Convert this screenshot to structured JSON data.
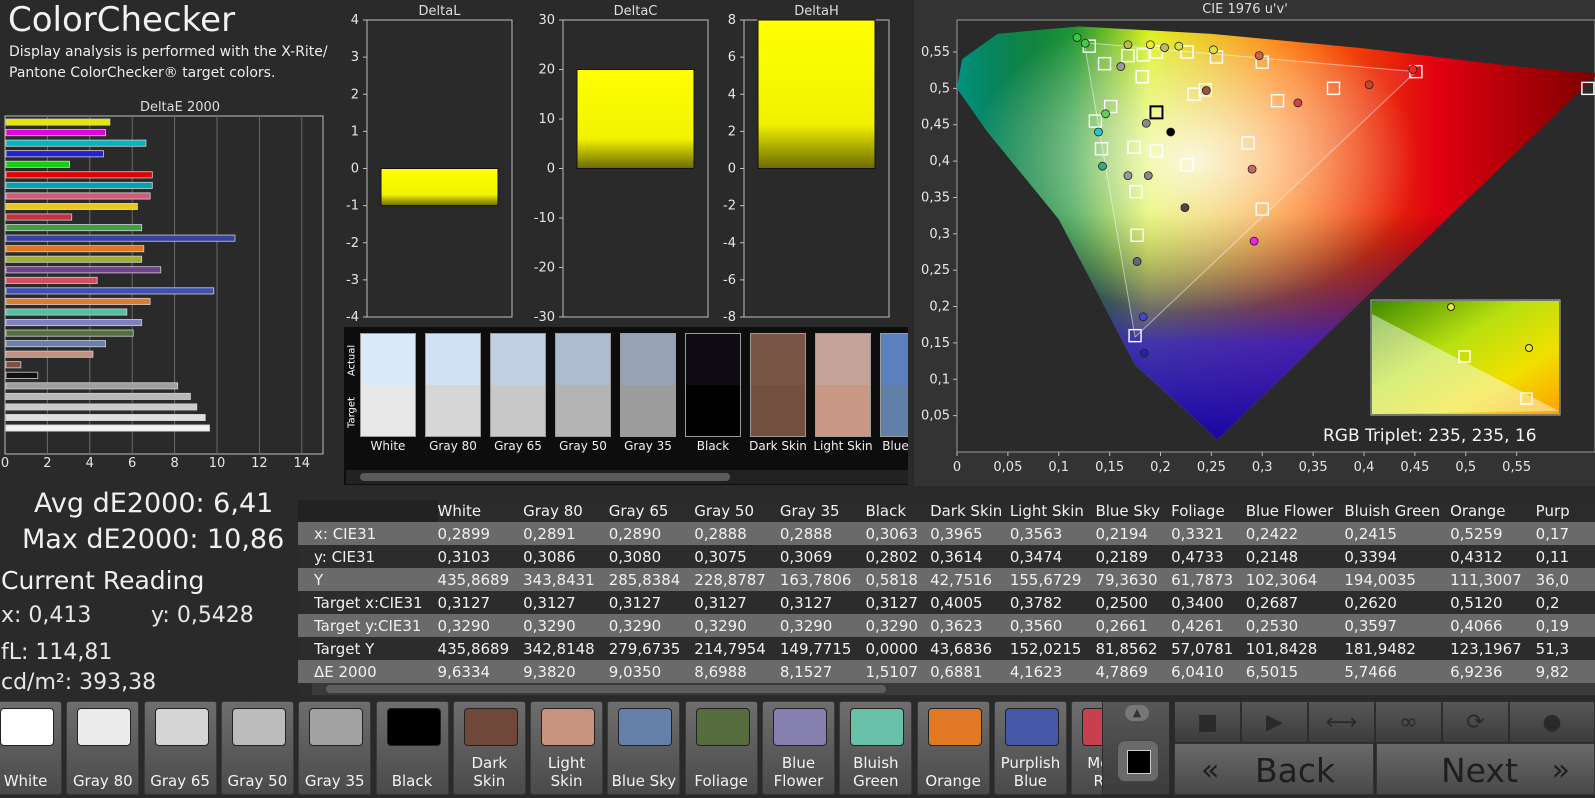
{
  "header": {
    "title": "ColorChecker",
    "subtitle": "Display analysis is performed with the X-Rite/ Pantone ColorChecker® target colors."
  },
  "deltae_chart": {
    "title": "DeltaE 2000",
    "ticks": [
      "0",
      "2",
      "4",
      "6",
      "8",
      "10",
      "12",
      "14"
    ],
    "xmax": 15,
    "bars": [
      {
        "value": 4.9,
        "color": "#e6e600"
      },
      {
        "value": 4.7,
        "color": "#e000e0"
      },
      {
        "value": 6.6,
        "color": "#00b6c4"
      },
      {
        "value": 4.6,
        "color": "#2222d0"
      },
      {
        "value": 3.0,
        "color": "#10d010"
      },
      {
        "value": 6.9,
        "color": "#e00000"
      },
      {
        "value": 6.9,
        "color": "#00a4b0"
      },
      {
        "value": 6.8,
        "color": "#d85878"
      },
      {
        "value": 6.2,
        "color": "#e8c820"
      },
      {
        "value": 3.1,
        "color": "#c83040"
      },
      {
        "value": 6.4,
        "color": "#40a040"
      },
      {
        "value": 10.8,
        "color": "#3840a0"
      },
      {
        "value": 6.5,
        "color": "#e07820"
      },
      {
        "value": 6.4,
        "color": "#a0b030"
      },
      {
        "value": 7.3,
        "color": "#704090"
      },
      {
        "value": 4.3,
        "color": "#d05060"
      },
      {
        "value": 9.8,
        "color": "#4050b0"
      },
      {
        "value": 6.8,
        "color": "#e07a30"
      },
      {
        "value": 5.7,
        "color": "#50c0a0"
      },
      {
        "value": 6.4,
        "color": "#8080c0"
      },
      {
        "value": 6.0,
        "color": "#507040"
      },
      {
        "value": 4.7,
        "color": "#6880b0"
      },
      {
        "value": 4.1,
        "color": "#c09080"
      },
      {
        "value": 0.7,
        "color": "#805040"
      },
      {
        "value": 1.5,
        "color": "#101010"
      },
      {
        "value": 8.1,
        "color": "#a0a0a0"
      },
      {
        "value": 8.7,
        "color": "#b8b8b8"
      },
      {
        "value": 9.0,
        "color": "#cccccc"
      },
      {
        "value": 9.4,
        "color": "#e0e0e0"
      },
      {
        "value": 9.6,
        "color": "#f4f4f4"
      }
    ]
  },
  "delta_charts": [
    {
      "title": "DeltaL",
      "ticks": [
        "4",
        "3",
        "2",
        "1",
        "0",
        "-1",
        "-2",
        "-3",
        "-4"
      ],
      "min": -4,
      "max": 4,
      "value": -1.0
    },
    {
      "title": "DeltaC",
      "ticks": [
        "30",
        "20",
        "10",
        "0",
        "-10",
        "-20",
        "-30"
      ],
      "min": -30,
      "max": 30,
      "value": 20
    },
    {
      "title": "DeltaH",
      "ticks": [
        "8",
        "6",
        "4",
        "2",
        "0",
        "-2",
        "-4",
        "-6",
        "-8"
      ],
      "min": -8,
      "max": 8,
      "value": 8
    }
  ],
  "strip": {
    "actual_label": "Actual",
    "target_label": "Target",
    "patches": [
      {
        "label": "White",
        "actual": "#dce9f8",
        "target": "#e8e8e8"
      },
      {
        "label": "Gray 80",
        "actual": "#d2e2f6",
        "target": "#d6d6d6"
      },
      {
        "label": "Gray 65",
        "actual": "#c2d0e4",
        "target": "#c8c8c8"
      },
      {
        "label": "Gray 50",
        "actual": "#aebccf",
        "target": "#b4b4b4"
      },
      {
        "label": "Gray 35",
        "actual": "#98a4b4",
        "target": "#9c9c9c"
      },
      {
        "label": "Black",
        "actual": "#0e0c12",
        "target": "#020202"
      },
      {
        "label": "Dark Skin",
        "actual": "#7a5444",
        "target": "#745040"
      },
      {
        "label": "Light Skin",
        "actual": "#c4a498",
        "target": "#c89884"
      },
      {
        "label": "Blue Sky",
        "actual": "#5a80c0",
        "target": "#6080a8"
      }
    ]
  },
  "cie": {
    "title": "CIE 1976 u'v'",
    "yticks": [
      "0,55",
      "0,5",
      "0,45",
      "0,4",
      "0,35",
      "0,3",
      "0,25",
      "0,2",
      "0,15",
      "0,1",
      "0,05"
    ],
    "xticks": [
      "0",
      "0,05",
      "0,1",
      "0,15",
      "0,2",
      "0,25",
      "0,3",
      "0,35",
      "0,4",
      "0,45",
      "0,5",
      "0,55"
    ],
    "rgb_triplet": "RGB Triplet: 235, 235, 16"
  },
  "stats": {
    "avg": "Avg dE2000: 6,41",
    "max": "Max dE2000: 10,86",
    "current_title": "Current Reading",
    "x": "x: 0,413",
    "y": "y: 0,5428",
    "fl": "fL: 114,81",
    "cd": "cd/m²: 393,38"
  },
  "table": {
    "columns": [
      "",
      "White",
      "Gray 80",
      "Gray 65",
      "Gray 50",
      "Gray 35",
      "Black",
      "Dark Skin",
      "Light Skin",
      "Blue Sky",
      "Foliage",
      "Blue Flower",
      "Bluish Green",
      "Orange",
      "Purp"
    ],
    "rows": [
      [
        "x: CIE31",
        "0,2899",
        "0,2891",
        "0,2890",
        "0,2888",
        "0,2888",
        "0,3063",
        "0,3965",
        "0,3563",
        "0,2194",
        "0,3321",
        "0,2422",
        "0,2415",
        "0,5259",
        "0,17"
      ],
      [
        "y: CIE31",
        "0,3103",
        "0,3086",
        "0,3080",
        "0,3075",
        "0,3069",
        "0,2802",
        "0,3614",
        "0,3474",
        "0,2189",
        "0,4733",
        "0,2148",
        "0,3394",
        "0,4312",
        "0,11"
      ],
      [
        "Y",
        "435,8689",
        "343,8431",
        "285,8384",
        "228,8787",
        "163,7806",
        "0,5818",
        "42,7516",
        "155,6729",
        "79,3630",
        "61,7873",
        "102,3064",
        "194,0035",
        "111,3007",
        "36,0"
      ],
      [
        "Target x:CIE31",
        "0,3127",
        "0,3127",
        "0,3127",
        "0,3127",
        "0,3127",
        "0,3127",
        "0,4005",
        "0,3782",
        "0,2500",
        "0,3400",
        "0,2687",
        "0,2620",
        "0,5120",
        "0,2"
      ],
      [
        "Target y:CIE31",
        "0,3290",
        "0,3290",
        "0,3290",
        "0,3290",
        "0,3290",
        "0,3290",
        "0,3623",
        "0,3560",
        "0,2661",
        "0,4261",
        "0,2530",
        "0,3597",
        "0,4066",
        "0,19"
      ],
      [
        "Target Y",
        "435,8689",
        "342,8148",
        "279,6735",
        "214,7954",
        "149,7715",
        "0,0000",
        "43,6836",
        "152,0215",
        "81,8562",
        "57,0781",
        "101,8428",
        "181,9482",
        "123,1967",
        "51,3"
      ],
      [
        "ΔE 2000",
        "9,6334",
        "9,3820",
        "9,0350",
        "8,6988",
        "8,1527",
        "1,5107",
        "0,6881",
        "4,1623",
        "4,7869",
        "6,0410",
        "6,5015",
        "5,7466",
        "6,9236",
        "9,82"
      ]
    ]
  },
  "swatches": [
    {
      "label": "White",
      "color": "#ffffff"
    },
    {
      "label": "Gray 80",
      "color": "#ececec"
    },
    {
      "label": "Gray 65",
      "color": "#d4d4d4"
    },
    {
      "label": "Gray 50",
      "color": "#bcbcbc"
    },
    {
      "label": "Gray 35",
      "color": "#a2a2a2"
    },
    {
      "label": "Black",
      "color": "#000000"
    },
    {
      "label": "Dark Skin",
      "color": "#70483a"
    },
    {
      "label": "Light Skin",
      "color": "#c89480"
    },
    {
      "label": "Blue Sky",
      "color": "#6480a8"
    },
    {
      "label": "Foliage",
      "color": "#566c3c"
    },
    {
      "label": "Blue Flower",
      "color": "#8680b0"
    },
    {
      "label": "Bluish Green",
      "color": "#68c0a8"
    },
    {
      "label": "Orange",
      "color": "#e07824"
    },
    {
      "label": "Purplish Blue",
      "color": "#4858a8"
    },
    {
      "label": "Mode Red",
      "color": "#c84050"
    }
  ],
  "nav": {
    "back_label": "Back",
    "next_label": "Next"
  },
  "controls": [
    "stop-icon",
    "play-icon",
    "fit-icon",
    "infinity-icon",
    "refresh-icon",
    "circle-icon"
  ]
}
